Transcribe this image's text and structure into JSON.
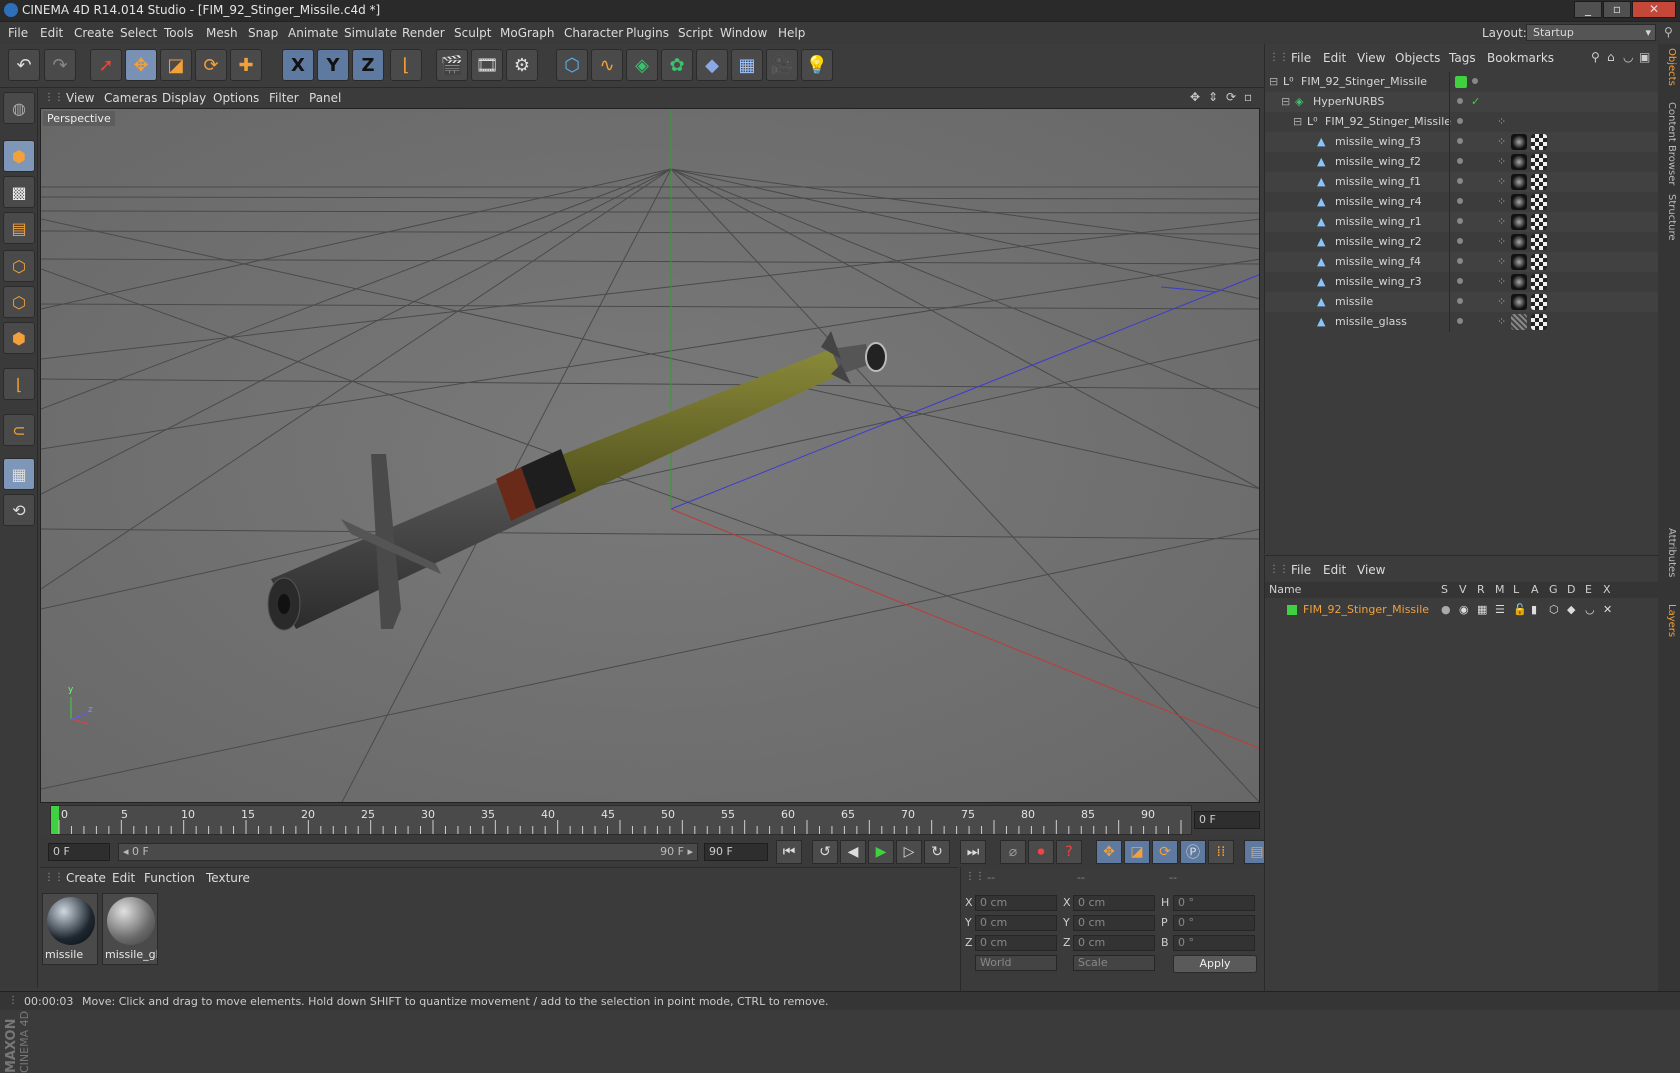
{
  "window": {
    "title": "CINEMA 4D R14.014 Studio - [FIM_92_Stinger_Missile.c4d *]",
    "controls": [
      "_",
      "▫",
      "✕"
    ]
  },
  "menu": [
    "File",
    "Edit",
    "Create",
    "Select",
    "Tools",
    "Mesh",
    "Snap",
    "Animate",
    "Simulate",
    "Render",
    "Sculpt",
    "MoGraph",
    "Character",
    "Plugins",
    "Script",
    "Window",
    "Help"
  ],
  "layout": {
    "label": "Layout:",
    "value": "Startup"
  },
  "toolbar": {
    "axis_x": "X",
    "axis_y": "Y",
    "axis_z": "Z"
  },
  "viewport": {
    "menu": [
      "View",
      "Cameras",
      "Display",
      "Options",
      "Filter",
      "Panel"
    ],
    "label": "Perspective",
    "axis_y": "y",
    "axis_z": "z"
  },
  "timeline": {
    "ticks": [
      "0",
      "5",
      "10",
      "15",
      "20",
      "25",
      "30",
      "35",
      "40",
      "45",
      "50",
      "55",
      "60",
      "65",
      "70",
      "75",
      "80",
      "85",
      "90"
    ],
    "current_frame": "0 F",
    "start_frame": "0 F",
    "range_start": "◂ 0 F",
    "range_end": "90 F ▸",
    "end_frame": "90 F"
  },
  "materials": {
    "menu": [
      "Create",
      "Edit",
      "Function",
      "Texture"
    ],
    "items": [
      {
        "label": "missile"
      },
      {
        "label": "missile_gla"
      }
    ]
  },
  "coordinates": {
    "headers": [
      "--",
      "--",
      "--"
    ],
    "rows": [
      {
        "l1": "X",
        "v1": "0 cm",
        "l2": "X",
        "v2": "0 cm",
        "l3": "H",
        "v3": "0 °"
      },
      {
        "l1": "Y",
        "v1": "0 cm",
        "l2": "Y",
        "v2": "0 cm",
        "l3": "P",
        "v3": "0 °"
      },
      {
        "l1": "Z",
        "v1": "0 cm",
        "l2": "Z",
        "v2": "0 cm",
        "l3": "B",
        "v3": "0 °"
      }
    ],
    "mode": "World",
    "scale": "Scale",
    "apply": "Apply"
  },
  "objects": {
    "menu": [
      "File",
      "Edit",
      "View",
      "Objects",
      "Tags",
      "Bookmarks"
    ],
    "items": [
      {
        "name": "FIM_92_Stinger_Missile",
        "indent": 0
      },
      {
        "name": "HyperNURBS",
        "indent": 1
      },
      {
        "name": "FIM_92_Stinger_Missile",
        "indent": 2
      },
      {
        "name": "missile_wing_f3",
        "indent": 3
      },
      {
        "name": "missile_wing_f2",
        "indent": 3
      },
      {
        "name": "missile_wing_f1",
        "indent": 3
      },
      {
        "name": "missile_wing_r4",
        "indent": 3
      },
      {
        "name": "missile_wing_r1",
        "indent": 3
      },
      {
        "name": "missile_wing_r2",
        "indent": 3
      },
      {
        "name": "missile_wing_f4",
        "indent": 3
      },
      {
        "name": "missile_wing_r3",
        "indent": 3
      },
      {
        "name": "missile",
        "indent": 3
      },
      {
        "name": "missile_glass",
        "indent": 3
      }
    ]
  },
  "layers": {
    "menu": [
      "File",
      "Edit",
      "View"
    ],
    "headers": [
      "Name",
      "S",
      "V",
      "R",
      "M",
      "L",
      "A",
      "G",
      "D",
      "E",
      "X"
    ],
    "items": [
      {
        "name": "FIM_92_Stinger_Missile",
        "color": "#3fd13f"
      }
    ]
  },
  "right_tabs": [
    "Objects",
    "Content Browser",
    "Structure",
    "Attributes",
    "Layers"
  ],
  "status": {
    "time": "00:00:03",
    "message": "Move: Click and drag to move elements. Hold down SHIFT to quantize movement / add to the selection in point mode, CTRL to remove."
  },
  "brand": {
    "line1": "MAXON",
    "line2": "CINEMA 4D"
  },
  "colors": {
    "accent": "#f2a03a",
    "selection": "#7891b5",
    "layer_green": "#3fd13f",
    "missile_body": "#6b6b2a"
  }
}
